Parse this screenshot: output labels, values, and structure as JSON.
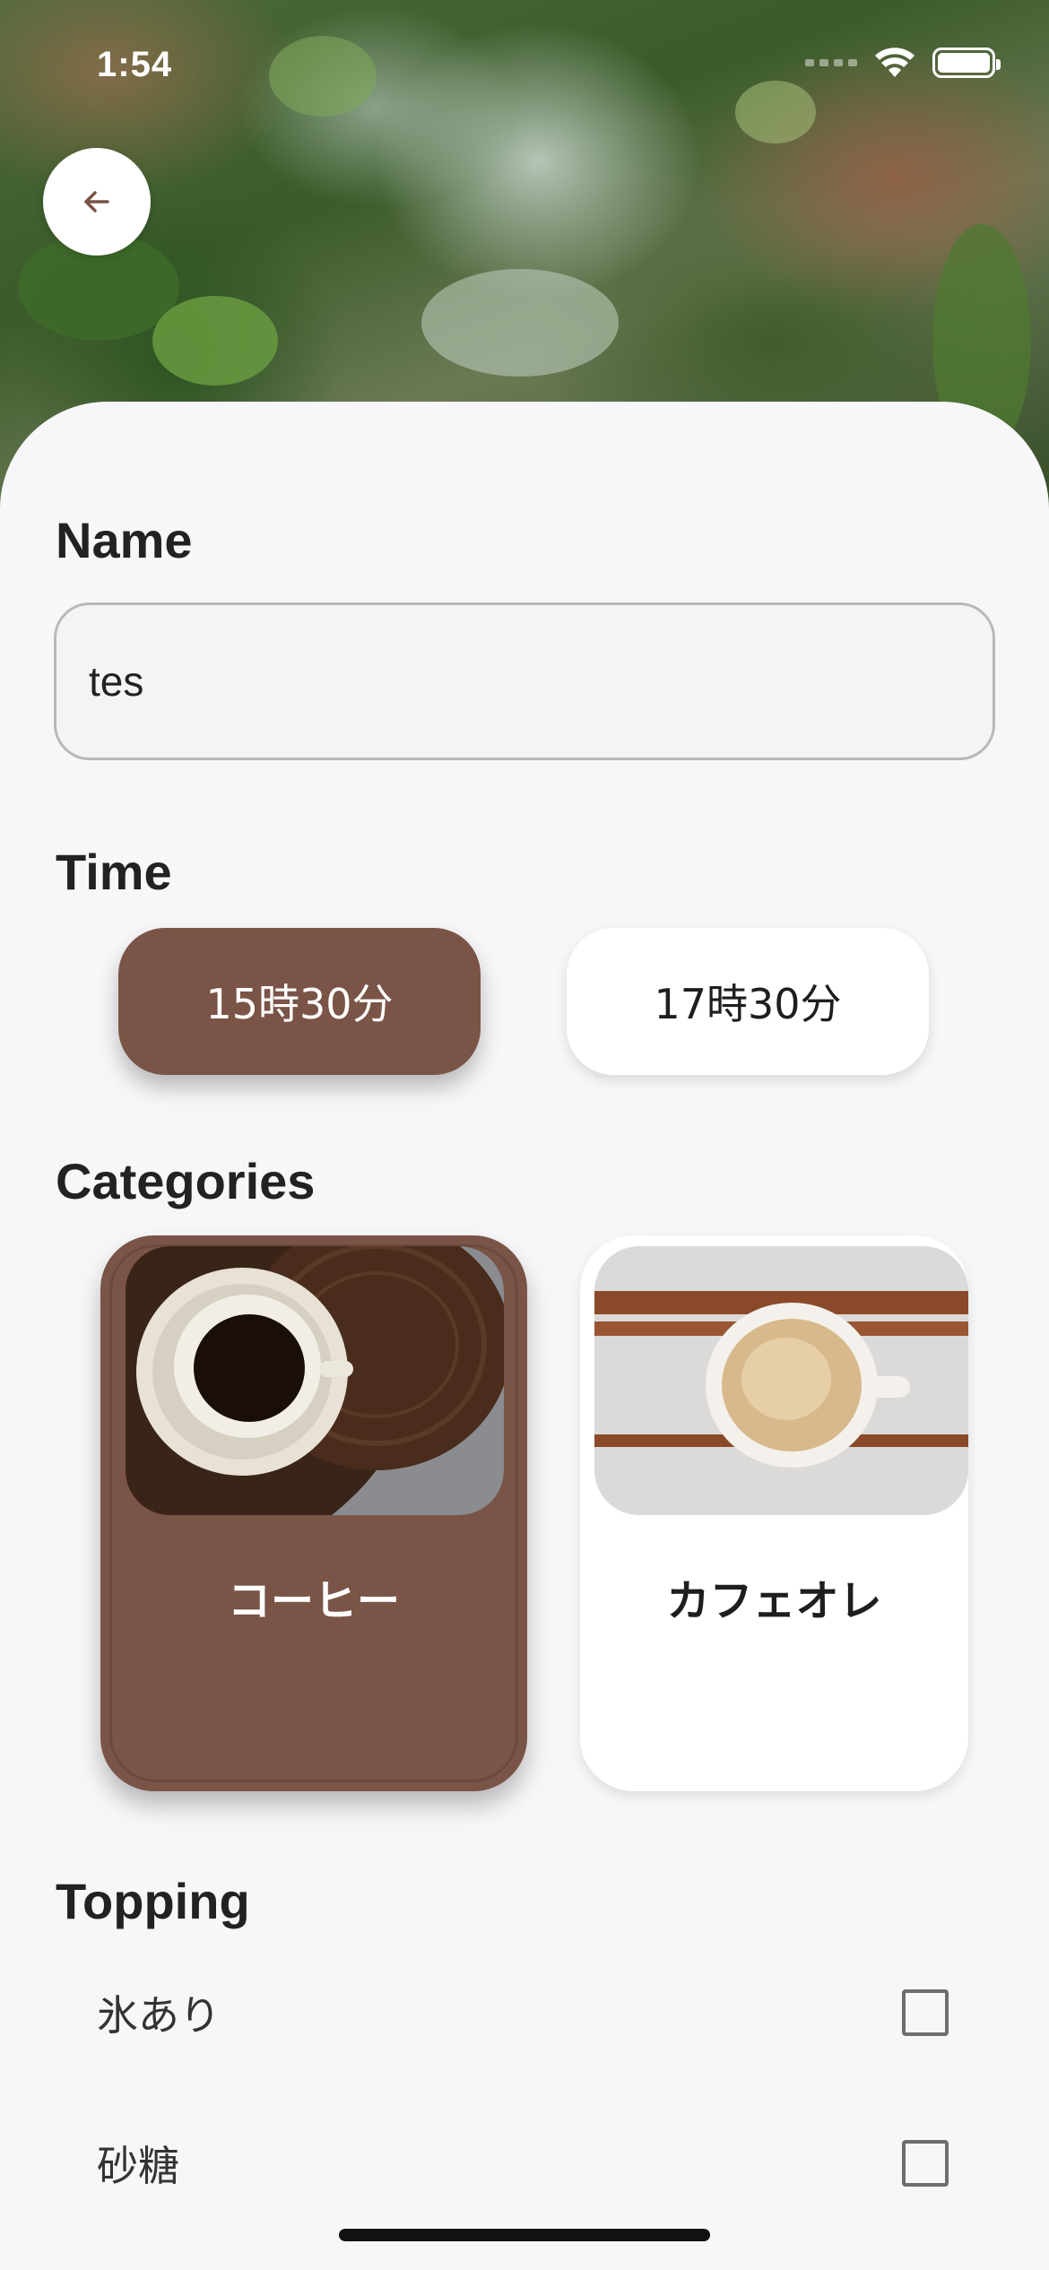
{
  "status_bar": {
    "time": "1:54"
  },
  "form": {
    "name": {
      "label": "Name",
      "value": "tes"
    },
    "time": {
      "label": "Time",
      "options": [
        {
          "label": "15時30分",
          "selected": true
        },
        {
          "label": "17時30分",
          "selected": false
        }
      ]
    },
    "categories": {
      "label": "Categories",
      "items": [
        {
          "label": "コーヒー",
          "selected": true
        },
        {
          "label": "カフェオレ",
          "selected": false
        }
      ]
    },
    "topping": {
      "label": "Topping",
      "items": [
        {
          "label": "氷あり",
          "checked": false
        },
        {
          "label": "砂糖",
          "checked": false
        }
      ]
    }
  },
  "colors": {
    "accent": "#7a5446",
    "background": "#f7f7f9"
  }
}
